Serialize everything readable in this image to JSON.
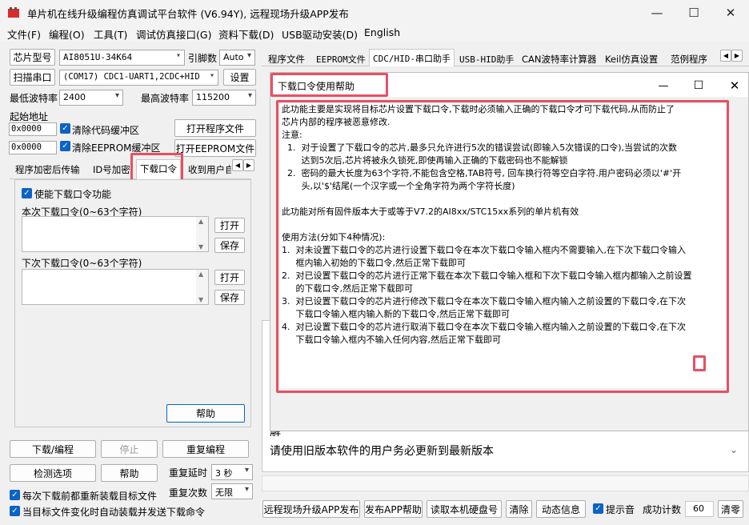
{
  "window": {
    "title": "单片机在线升级编程仿真调试平台软件 (V6.94Y), 远程现场升级APP发布"
  },
  "menu": [
    "文件(F)",
    "编程(O)",
    "工具(T)",
    "调试仿真接口(G)",
    "资料下载(D)",
    "USB驱动安装(D)",
    "English"
  ],
  "left": {
    "chip_label": "芯片型号",
    "chip_value": "AI8051U-34K64",
    "pins_label": "引脚数",
    "pins_value": "Auto",
    "scan_label": "扫描串口",
    "port_value": "(COM17) CDC1-UART1,2CDC+HID",
    "settings_label": "设置",
    "min_baud_label": "最低波特率",
    "min_baud_value": "2400",
    "max_baud_label": "最高波特率",
    "max_baud_value": "115200",
    "start_addr_label": "起始地址",
    "addr1": "0x0000",
    "clear_code_label": "清除代码缓冲区",
    "addr2": "0x0000",
    "clear_eeprom_label": "清除EEPROM缓冲区",
    "open_prog_label": "打开程序文件",
    "open_eeprom_label": "打开EEPROM文件",
    "tabs": [
      "程序加密后传输",
      "ID号加密",
      "下载口令",
      "收到用户自"
    ],
    "enable_pw_label": "使能下载口令功能",
    "this_pw_label": "本次下载口令(0~63个字符)",
    "next_pw_label": "下次下载口令(0~63个字符)",
    "open_label": "打开",
    "save_label": "保存",
    "help_label": "帮助",
    "download_label": "下载/编程",
    "stop_label": "停止",
    "reprog_label": "重复编程",
    "detect_label": "检测选项",
    "help2_label": "帮助",
    "repeat_delay_label": "重复延时",
    "repeat_delay_value": "3 秒",
    "repeat_count_label": "重复次数",
    "repeat_count_value": "无限",
    "reload_label": "每次下载前都重新装载目标文件",
    "autosend_label": "当目标文件变化时自动装载并发送下载命令"
  },
  "right": {
    "tabs": [
      "程序文件",
      "EEPROM文件",
      "CDC/HID-串口助手",
      "USB-HID助手",
      "CAN波特率计算器",
      "Keil仿真设置",
      "范例程序"
    ],
    "behind_texts": [
      "I",
      "软",
      "解",
      "请使用旧版本软件的用户务必更新到最新版本"
    ],
    "bottom_buttons": [
      "远程现场升级APP发布",
      "发布APP帮助",
      "读取本机硬盘号",
      "清除",
      "动态信息"
    ],
    "beep_label": "提示音",
    "success_label": "成功计数",
    "success_value": "60",
    "clear_label": "清零"
  },
  "dialog": {
    "title": "下载口令使用帮助",
    "lines": [
      "此功能主要是实现将目标芯片设置下载口令,下载时必须输入正确的下载口令才可下载代码,从而防止了",
      "芯片内部的程序被恶意修改.",
      "注意:",
      "  1.  对于设置了下载口令的芯片,最多只允许进行5次的错误尝试(即输入5次错误的口令),当尝试的次数",
      "       达到5次后,芯片将被永久锁死,即使再输入正确的下载密码也不能解锁",
      "  2.  密码的最大长度为63个字符,不能包含空格,TAB符号, 回车换行符等空白字符.用户密码必须以'#'开",
      "       头,以'$'结尾(一个汉字或一个全角字符为两个字符长度)",
      "",
      "此功能对所有固件版本大于或等于V7.2的AI8xx/STC15xx系列的单片机有效",
      "",
      "使用方法(分如下4种情况):",
      "1.  对未设置下载口令的芯片进行设置下载口令在本次下载口令输入框内不需要输入,在下次下载口令输入",
      "     框内输入初始的下载口令,然后正常下载即可",
      "2.  对已设置下载口令的芯片进行正常下载在本次下载口令输入框和下次下载口令输入框内都输入之前设置",
      "     的下载口令,然后正常下载即可",
      "3.  对已设置下载口令的芯片进行修改下载口令在本次下载口令输入框内输入之前设置的下载口令,在下次",
      "     下载口令输入框内输入新的下载口令,然后正常下载即可",
      "4.  对已设置下载口令的芯片进行取消下载口令在本次下载口令输入框内输入之前设置的下载口令,在下次",
      "     下载口令输入框内不输入任何内容,然后正常下载即可"
    ]
  }
}
